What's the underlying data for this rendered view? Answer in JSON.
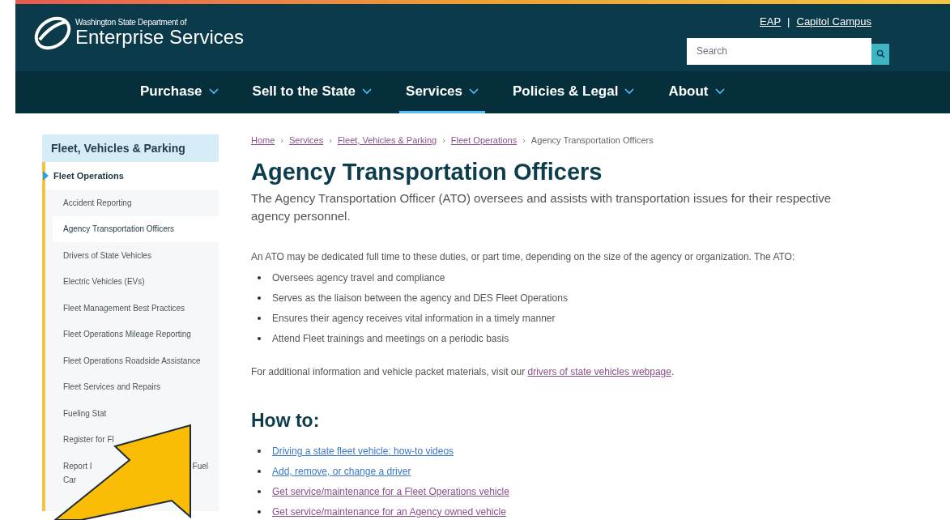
{
  "header": {
    "logo_small": "Washington State Department of",
    "logo_large": "Enterprise Services",
    "utility_links": [
      "EAP",
      "Capitol Campus"
    ],
    "utility_separator": "|",
    "search": {
      "placeholder": "Search"
    }
  },
  "nav": [
    {
      "label": "Purchase",
      "selected": false
    },
    {
      "label": "Sell to the State",
      "selected": false
    },
    {
      "label": "Services",
      "selected": true
    },
    {
      "label": "Policies & Legal",
      "selected": false
    },
    {
      "label": "About",
      "selected": false
    }
  ],
  "sidebar": {
    "title": "Fleet, Vehicles & Parking",
    "section": "Fleet Operations",
    "items": [
      {
        "label": "Accident Reporting",
        "selected": false
      },
      {
        "label": "Agency Transportation Officers",
        "selected": true
      },
      {
        "label": "Drivers of State Vehicles",
        "selected": false
      },
      {
        "label": "Electric Vehicles (EVs)",
        "selected": false
      },
      {
        "label": "Fleet Management Best Practices",
        "selected": false
      },
      {
        "label": "Fleet Operations Mileage Reporting",
        "selected": false
      },
      {
        "label": "Fleet Operations Roadside Assistance",
        "selected": false
      },
      {
        "label": "Fleet Services and Repairs",
        "selected": false
      },
      {
        "label": "Fueling Stat",
        "selected": false
      },
      {
        "label": "Register for Fl",
        "selected": false
      },
      {
        "label": "Report I",
        "tail": "Fuel",
        "second_line": "Car",
        "selected": false
      }
    ]
  },
  "breadcrumb": [
    "Home",
    "Services",
    "Fleet, Vehicles & Parking",
    "Fleet Operations",
    "Agency Transportation Officers"
  ],
  "breadcrumb_separator": "›",
  "title": "Agency Transportation Officers",
  "lead": "The Agency Transportation Officer (ATO) oversees and assists with transportation issues for their respective agency personnel.",
  "paragraph": "An ATO may be dedicated full time to these duties, or part time, depending on the size of the agency or organization. The ATO:",
  "duties": [
    "Oversees agency travel and compliance",
    "Serves as the liaison between the agency and DES Fleet Operations",
    "Ensures their agency receives vital information in a timely manner",
    "Attend Fleet trainings and meetings on a periodic basis"
  ],
  "more_info": {
    "text": "For additional information and vehicle packet materials, visit our",
    "link": "drivers of state vehicles webpage",
    "end": "."
  },
  "how_to": {
    "title": "How to:",
    "links": [
      {
        "label": "Driving a state fleet vehicle: how-to videos",
        "visited": false
      },
      {
        "label": "Add, remove, or change a driver",
        "visited": false
      },
      {
        "label": "Get service/maintenance for a Fleet Operations vehicle",
        "visited": true
      },
      {
        "label": "Get service/maintenance for an Agency owned vehicle",
        "visited": true
      }
    ]
  }
}
